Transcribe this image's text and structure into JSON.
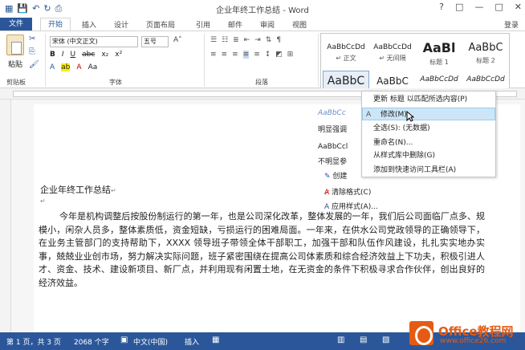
{
  "window": {
    "title": "企业年终工作总结 - Word",
    "controls": [
      "?",
      "□",
      "—",
      "□",
      "✕"
    ]
  },
  "tabs": {
    "file": "文件",
    "active": "开始",
    "others": [
      "插入",
      "设计",
      "页面布局",
      "引用",
      "邮件",
      "审阅",
      "视图"
    ],
    "login": "登录"
  },
  "ribbon": {
    "groups": {
      "clipboard": "剪贴板",
      "font": "字体",
      "paragraph": "段落"
    },
    "paste": "粘贴",
    "font_name": "宋体 (中文正文)",
    "font_size": "五号",
    "format_row1": [
      "B",
      "I",
      "U",
      "abc",
      "x₂",
      "x²"
    ],
    "styles": [
      {
        "sample": "AaBbCcDd",
        "name": "↵ 正文"
      },
      {
        "sample": "AaBbCcDd",
        "name": "↵ 无间隔"
      },
      {
        "sample": "AaBl",
        "name": "标题 1"
      },
      {
        "sample": "AaBbC",
        "name": "标题 2"
      },
      {
        "sample": "AaBbC",
        "name": "标题"
      },
      {
        "sample": "AaBbC",
        "name": ""
      },
      {
        "sample": "AaBbCcDd",
        "name": ""
      },
      {
        "sample": "AaBbCcDd",
        "name": ""
      }
    ]
  },
  "context_menu": {
    "items": [
      {
        "label": "更新 标题 以匹配所选内容(P)",
        "icon": ""
      },
      {
        "label": "修改(M)...",
        "icon": "A"
      },
      {
        "label": "全选(S): (无数据)",
        "icon": ""
      },
      {
        "label": "重命名(N)...",
        "icon": ""
      },
      {
        "label": "从样式库中删除(G)",
        "icon": ""
      },
      {
        "label": "添加到快速访问工具栏(A)",
        "icon": ""
      }
    ]
  },
  "side_items": {
    "apply_sample": "AaBbCc",
    "sample2": "AaBbCc",
    "emphasis": "明显强调",
    "sample3": "AaBbCcl",
    "ref": "不明显参",
    "create": "创建",
    "clear": "清除格式(C)",
    "apply": "应用样式(A)..."
  },
  "document": {
    "title": "企业年终工作总结",
    "paragraph": "今年是机构调整后按股份制运行的第一年，也是公司深化改革，整体发展的一年，我们后公司面临厂点多、规模小，闲杂人员多，整体素质低，资金短缺，亏损运行的困难局面。一年来，在供水公司党政领导的正确领导下，在业务主管部门的支持帮助下，XXXX 领导班子带领全体干部职工，加强干部和队伍作风建设，扎扎实实地办实事，兢兢业业创市场，努力解决实际问题，班子紧密围绕在提高公司体素质和综合经济效益上下功夫，积极引进人才、资金、技术、建设新项目、新厂点，并利用现有闲置土地，在无资金的条件下积极寻求合作伙伴，创出良好的经济效益。"
  },
  "statusbar": {
    "page": "第 1 页，共 3 页",
    "words": "2068 个字",
    "lang": "中文(中国)",
    "mode": "插入"
  },
  "brand": {
    "name": "Office教程网",
    "url": "www.office26.com"
  },
  "colors": {
    "accent": "#2b579a",
    "brand": "#e55b13"
  }
}
